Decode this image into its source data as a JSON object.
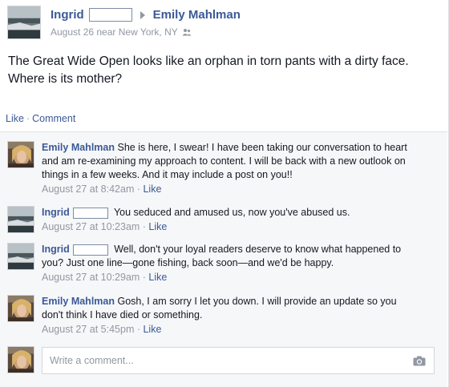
{
  "post": {
    "author": "Ingrid",
    "target": "Emily Mahlman",
    "meta": "August 26 near New York, NY",
    "privacy_icon": "people-icon",
    "text": "The Great Wide Open looks like an orphan in torn pants with a dirty face. Where is its mother?"
  },
  "actions": {
    "like": "Like",
    "separator": "·",
    "comment": "Comment"
  },
  "comments": [
    {
      "name": "Emily Mahlman",
      "text": "She is here, I swear! I have been taking our conversation to heart and am re-examining my approach to content. I will be back with a new outlook on things in a few weeks. And it may include a post on you!!",
      "time": "August 27 at 8:42am",
      "like": "Like",
      "redacted": false
    },
    {
      "name": "Ingrid",
      "text": "You seduced and amused us, now you've abused us.",
      "time": "August 27 at 10:23am",
      "like": "Like",
      "redacted": true
    },
    {
      "name": "Ingrid",
      "text": "Well, don't your loyal readers deserve to know what happened to you? Just one line—gone fishing, back soon—and we'd be happy.",
      "time": "August 27 at 10:29am",
      "like": "Like",
      "redacted": true
    },
    {
      "name": "Emily Mahlman",
      "text": "Gosh, I am sorry I let you down. I will provide an update so you don't think I have died or something.",
      "time": "August 27 at 5:45pm",
      "like": "Like",
      "redacted": false
    }
  ],
  "compose": {
    "placeholder": "Write a comment...",
    "icon": "camera-icon"
  },
  "colors": {
    "link": "#3b5998",
    "meta": "#9197a3",
    "text": "#141823",
    "comments_bg": "#f6f7f8"
  }
}
